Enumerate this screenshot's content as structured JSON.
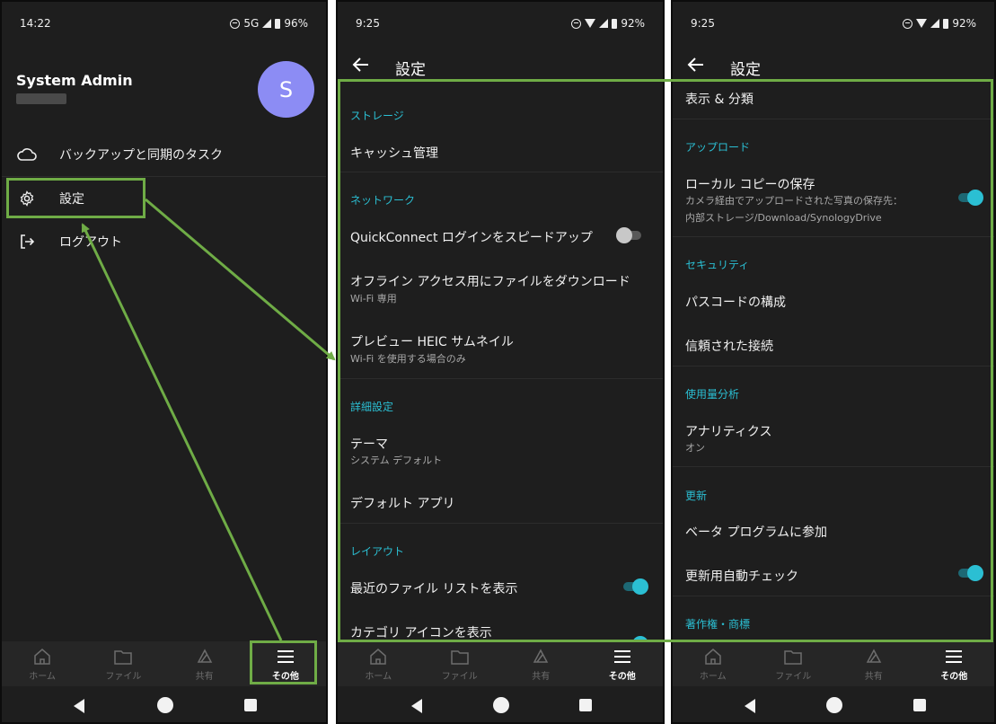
{
  "panel1": {
    "status": {
      "time": "14:22",
      "network": "5G",
      "battery": "96%"
    },
    "profile": {
      "name": "System Admin",
      "avatar_letter": "S"
    },
    "menu": [
      {
        "icon": "cloud-icon",
        "label": "バックアップと同期のタスク"
      },
      {
        "icon": "gear-icon",
        "label": "設定"
      },
      {
        "icon": "logout-icon",
        "label": "ログアウト"
      }
    ]
  },
  "panel2": {
    "status": {
      "time": "9:25",
      "battery": "92%"
    },
    "title": "設定",
    "sections": {
      "storage": "ストレージ",
      "network": "ネットワーク",
      "advanced": "詳細設定",
      "layout": "レイアウト"
    },
    "items": {
      "cache": "キャッシュ管理",
      "quickconnect": "QuickConnect ログインをスピードアップ",
      "offline_title": "オフライン アクセス用にファイルをダウンロード",
      "offline_sub": "Wi-Fi 専用",
      "heic_title": "プレビュー HEIC サムネイル",
      "heic_sub": "Wi-Fi を使用する場合のみ",
      "theme_title": "テーマ",
      "theme_sub": "システム デフォルト",
      "default_app": "デフォルト アプリ",
      "recent_files": "最近のファイル リストを表示",
      "category_icons": "カテゴリ アイコンを表示"
    },
    "toggles": {
      "quickconnect": false,
      "recent_files": true,
      "category_icons": true
    }
  },
  "panel3": {
    "status": {
      "time": "9:25",
      "battery": "92%"
    },
    "title": "設定",
    "sections": {
      "upload": "アップロード",
      "security": "セキュリティ",
      "usage": "使用量分析",
      "update": "更新",
      "copyright": "著作権・商標"
    },
    "items": {
      "display": "表示 & 分類",
      "local_copy_title": "ローカル コピーの保存",
      "local_copy_sub1": "カメラ経由でアップロードされた写真の保存先：",
      "local_copy_sub2": "内部ストレージ/Download/SynologyDrive",
      "passcode": "パスコードの構成",
      "trusted": "信頼された接続",
      "analytics_title": "アナリティクス",
      "analytics_sub": "オン",
      "beta": "ベータ プログラムに参加",
      "auto_check": "更新用自動チェック"
    },
    "toggles": {
      "local_copy": true,
      "auto_check": true
    }
  },
  "bottom_nav": [
    {
      "icon": "home-icon",
      "label": "ホーム"
    },
    {
      "icon": "folder-icon",
      "label": "ファイル"
    },
    {
      "icon": "share-icon",
      "label": "共有"
    },
    {
      "icon": "menu-icon",
      "label": "その他"
    }
  ],
  "colors": {
    "accent": "#2bbfd3",
    "background": "#1e1e1e",
    "annotation": "#6fac46",
    "avatar": "#8c8cf4"
  }
}
